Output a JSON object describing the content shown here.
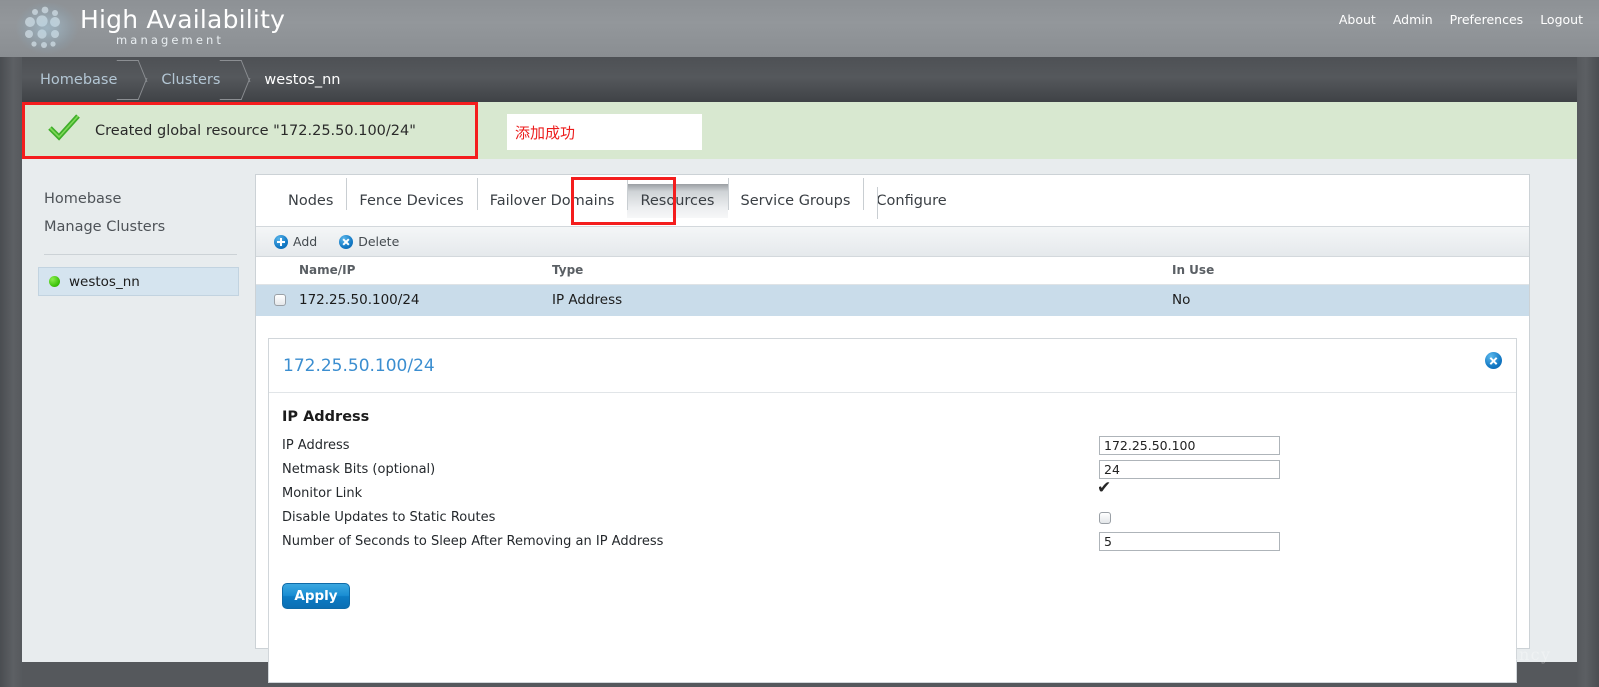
{
  "header": {
    "brand_main": "High Availability",
    "brand_sub": "management",
    "logo_icon": "cluster-dots-logo",
    "topnav": [
      {
        "label": "About"
      },
      {
        "label": "Admin"
      },
      {
        "label": "Preferences"
      },
      {
        "label": "Logout"
      }
    ]
  },
  "breadcrumb": [
    {
      "label": "Homebase"
    },
    {
      "label": "Clusters"
    },
    {
      "label": "westos_nn"
    }
  ],
  "banner": {
    "icon": "green-check-icon",
    "message": "Created global resource \"172.25.50.100/24\"",
    "annotation": "添加成功",
    "annotation_color": "#ec1c1c",
    "background_color": "#d8e8d0",
    "highlight_border_color": "#f41d1d"
  },
  "sidebar": {
    "links": [
      {
        "label": "Homebase"
      },
      {
        "label": "Manage Clusters"
      }
    ],
    "clusters": [
      {
        "label": "westos_nn",
        "status_icon": "green-status-dot",
        "status_color": "#3bc209",
        "selected": true
      }
    ]
  },
  "main": {
    "tabs": [
      {
        "label": "Nodes",
        "active": false
      },
      {
        "label": "Fence Devices",
        "active": false
      },
      {
        "label": "Failover Domains",
        "active": false
      },
      {
        "label": "Resources",
        "active": true
      },
      {
        "label": "Service Groups",
        "active": false
      },
      {
        "label": "Configure",
        "active": false
      }
    ],
    "toolbar": [
      {
        "label": "Add",
        "icon": "add-circle-icon"
      },
      {
        "label": "Delete",
        "icon": "delete-circle-icon"
      }
    ],
    "table": {
      "columns": [
        "",
        "Name/IP",
        "Type",
        "In Use"
      ],
      "rows": [
        {
          "checked": false,
          "name": "172.25.50.100/24",
          "type": "IP Address",
          "in_use": "No"
        }
      ]
    },
    "detail": {
      "title": "172.25.50.100/24",
      "close_icon": "close-circle-icon",
      "section_title": "IP Address",
      "fields": [
        {
          "label": "IP Address",
          "type": "text",
          "value": "172.25.50.100"
        },
        {
          "label": "Netmask Bits (optional)",
          "type": "text",
          "value": "24"
        },
        {
          "label": "Monitor Link",
          "type": "checkbox",
          "checked": true
        },
        {
          "label": "Disable Updates to Static Routes",
          "type": "checkbox",
          "checked": false
        },
        {
          "label": "Number of Seconds to Sleep After Removing an IP Address",
          "type": "text",
          "value": "5"
        }
      ],
      "apply_label": "Apply"
    }
  },
  "watermark": "https://blog.csdn.net/JaneNancy"
}
